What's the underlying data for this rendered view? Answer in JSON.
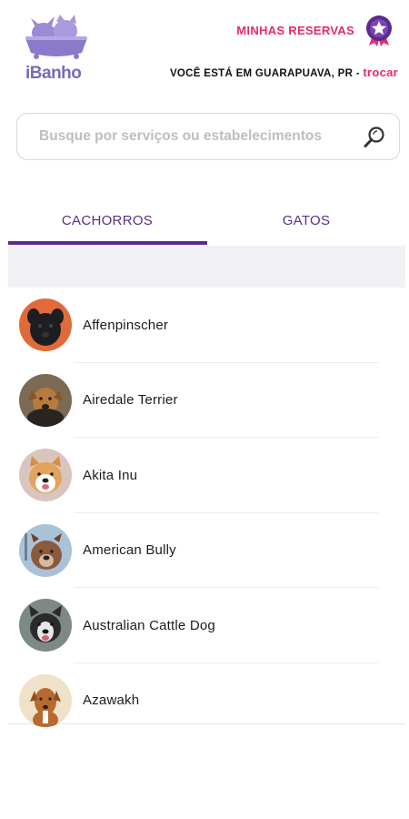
{
  "app": {
    "logo_text": "iBanho"
  },
  "header": {
    "reservas_label": "MINHAS RESERVAS",
    "location_prefix": "VOCÊ ESTÁ EM GUARAPUAVA, PR - ",
    "location_action": "trocar"
  },
  "search": {
    "placeholder": "Busque por serviços ou estabelecimentos",
    "value": ""
  },
  "tabs": [
    {
      "label": "CACHORROS",
      "active": true
    },
    {
      "label": "GATOS",
      "active": false
    }
  ],
  "breeds": [
    {
      "name": "Affenpinscher"
    },
    {
      "name": "Airedale Terrier"
    },
    {
      "name": "Akita Inu"
    },
    {
      "name": "American Bully"
    },
    {
      "name": "Australian Cattle Dog"
    },
    {
      "name": "Azawakh"
    }
  ],
  "colors": {
    "brand_purple": "#5b2a8e",
    "accent_pink": "#e8296e",
    "logo_lavender": "#7a69b8"
  },
  "icons": {
    "logo": "cat-dog-bath-logo",
    "reservas": "medal-ribbon-icon",
    "search": "magnifier-icon"
  }
}
